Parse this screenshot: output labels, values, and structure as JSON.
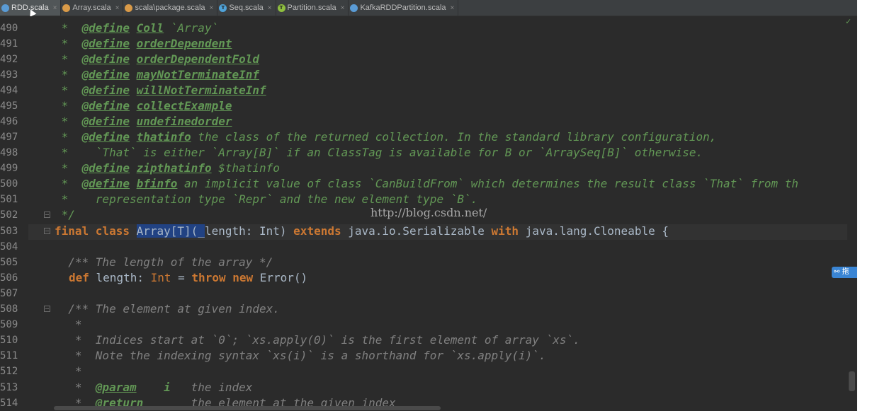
{
  "tabs": [
    {
      "label": "RDD.scala",
      "icon": "scala-object-icon",
      "color": "#5a9bd5",
      "glyph": "",
      "active": true
    },
    {
      "label": "Array.scala",
      "icon": "scala-class-icon",
      "color": "#d99a48",
      "glyph": "",
      "active": false
    },
    {
      "label": "scala\\package.scala",
      "icon": "scala-package-icon",
      "color": "#d99a48",
      "glyph": "",
      "active": false
    },
    {
      "label": "Seq.scala",
      "icon": "scala-trait-icon",
      "color": "#4fa3d9",
      "glyph": "T",
      "active": false
    },
    {
      "label": "Partition.scala",
      "icon": "scala-trait-icon",
      "color": "#8fbf3f",
      "glyph": "T",
      "active": false
    },
    {
      "label": "KafkaRDDPartition.scala",
      "icon": "scala-class-icon",
      "color": "#5a9bd5",
      "glyph": "",
      "active": false
    }
  ],
  "tab_close_glyph": "×",
  "watermark": "http://blog.csdn.net/",
  "check_mark": "✓",
  "side_widget_text": "⚯ 拖",
  "code": {
    "l490": {
      "num": "490",
      "star": " *  ",
      "tag": "@define",
      "sp": " ",
      "name": "Coll",
      "rest": " `Array`"
    },
    "l491": {
      "num": "491",
      "star": " *  ",
      "tag": "@define",
      "sp": " ",
      "name": "orderDependent",
      "rest": ""
    },
    "l492": {
      "num": "492",
      "star": " *  ",
      "tag": "@define",
      "sp": " ",
      "name": "orderDependentFold",
      "rest": ""
    },
    "l493": {
      "num": "493",
      "star": " *  ",
      "tag": "@define",
      "sp": " ",
      "name": "mayNotTerminateInf",
      "rest": ""
    },
    "l494": {
      "num": "494",
      "star": " *  ",
      "tag": "@define",
      "sp": " ",
      "name": "willNotTerminateInf",
      "rest": ""
    },
    "l495": {
      "num": "495",
      "star": " *  ",
      "tag": "@define",
      "sp": " ",
      "name": "collectExample",
      "rest": ""
    },
    "l496": {
      "num": "496",
      "star": " *  ",
      "tag": "@define",
      "sp": " ",
      "name": "undefinedorder",
      "rest": ""
    },
    "l497": {
      "num": "497",
      "star": " *  ",
      "tag": "@define",
      "sp": " ",
      "name": "thatinfo",
      "rest": " the class of the returned collection. In the standard library configuration,"
    },
    "l498": {
      "num": "498",
      "text": " *    `That` is either `Array[B]` if an ClassTag is available for B or `ArraySeq[B]` otherwise."
    },
    "l499": {
      "num": "499",
      "star": " *  ",
      "tag": "@define",
      "sp": " ",
      "name": "zipthatinfo",
      "rest": " $thatinfo"
    },
    "l500": {
      "num": "500",
      "star": " *  ",
      "tag": "@define",
      "sp": " ",
      "name": "bfinfo",
      "rest": " an implicit value of class `CanBuildFrom` which determines the result class `That` from th"
    },
    "l501": {
      "num": "501",
      "text": " *    representation type `Repr` and the new element type `B`."
    },
    "l502": {
      "num": "502",
      "text": " */"
    },
    "l503": {
      "num": "503",
      "kw1": "final class",
      "cls": " ",
      "sel": "Array[T](_",
      "after": "length: ",
      "int": "Int",
      "paren": ") ",
      "kw2": "extends",
      "mid": " java.io.Serializable ",
      "kw3": "with",
      "end": " java.lang.Cloneable {"
    },
    "l504": {
      "num": "504"
    },
    "l505": {
      "num": "505",
      "text": "  /** The length of the array */"
    },
    "l506": {
      "num": "506",
      "kw1": "def",
      "mid": " length: ",
      "ty": "Int",
      "eq": " = ",
      "kw2": "throw new",
      "end": " Error()"
    },
    "l507": {
      "num": "507"
    },
    "l508": {
      "num": "508",
      "text": "  /** The element at given index."
    },
    "l509": {
      "num": "509",
      "text": "   *"
    },
    "l510": {
      "num": "510",
      "text": "   *  Indices start at `0`; `xs.apply(0)` is the first element of array `xs`."
    },
    "l511": {
      "num": "511",
      "text": "   *  Note the indexing syntax `xs(i)` is a shorthand for `xs.apply(i)`."
    },
    "l512": {
      "num": "512",
      "text": "   *"
    },
    "l513": {
      "num": "513",
      "star": "   *  ",
      "tag": "@param",
      "sp": "    ",
      "name": "i",
      "rest": "   the index"
    },
    "l514": {
      "num": "514",
      "star": "   *  ",
      "tag": "@return",
      "sp": "       ",
      "name": "",
      "rest": "the element at the given index"
    }
  }
}
